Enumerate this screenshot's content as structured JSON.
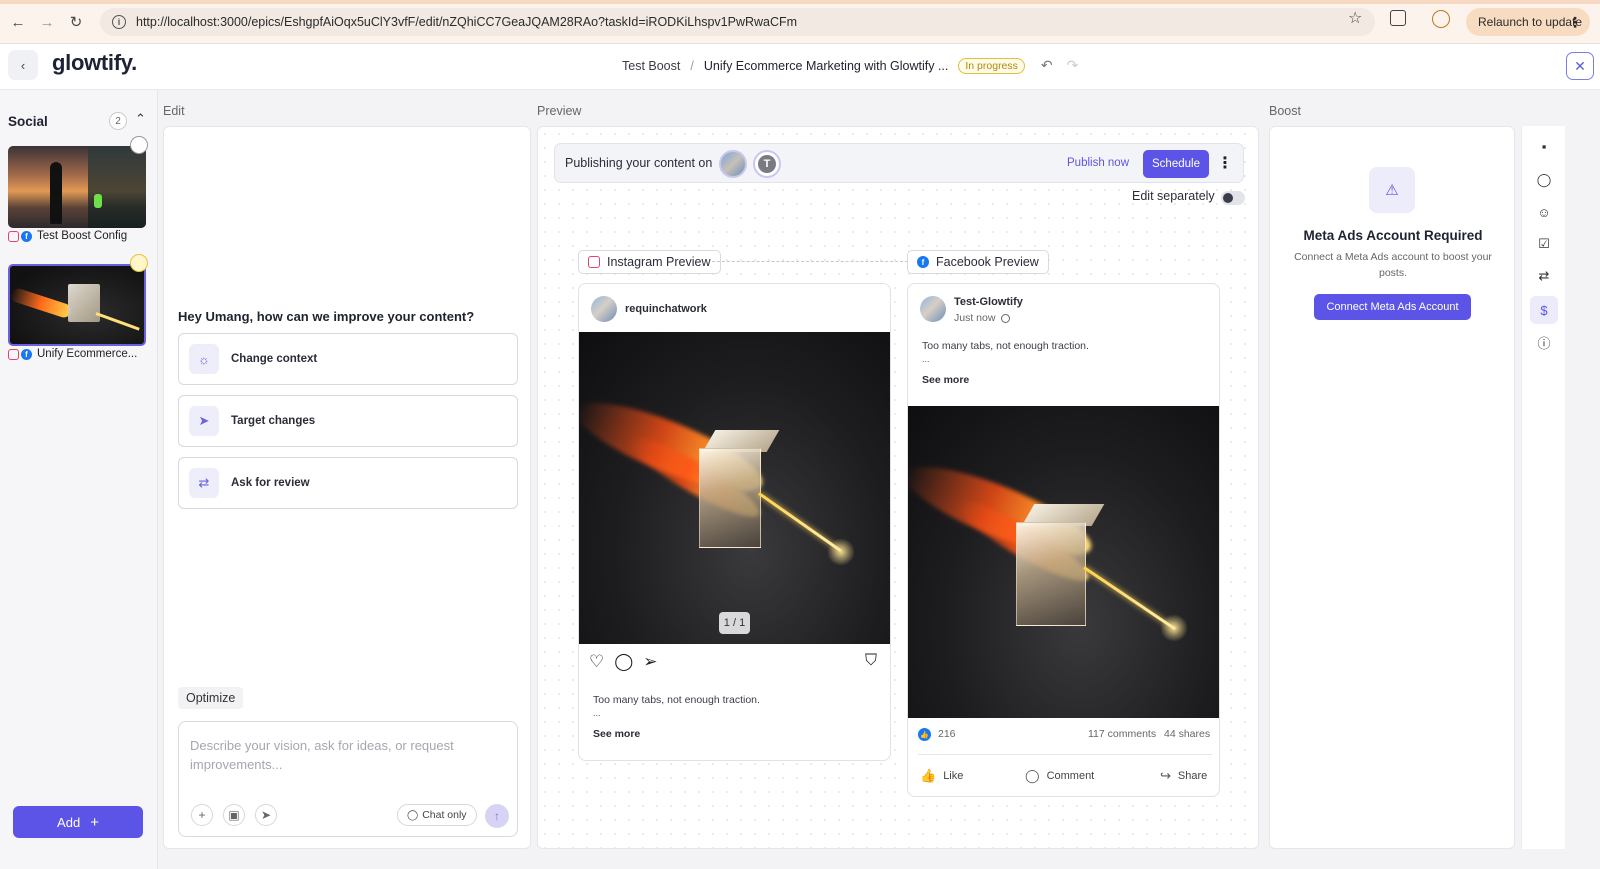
{
  "browser": {
    "url": "http://localhost:3000/epics/EshgpfAiOqx5uClY3vfF/edit/nZQhiCC7GeaJQAM28RAo?taskId=iRODKiLhspv1PwRwaCFm",
    "relaunch_label": "Relaunch to update"
  },
  "app": {
    "logo": "glowtify.",
    "breadcrumb": {
      "parent": "Test Boost",
      "separator": "/",
      "current": "Unify Ecommerce Marketing with Glowtify ...",
      "status": "In progress"
    }
  },
  "sidebar": {
    "title": "Social",
    "count": "2",
    "items": [
      {
        "label": "Test Boost Config"
      },
      {
        "label": "Unify Ecommerce..."
      }
    ],
    "add_label": "Add"
  },
  "sections": {
    "edit": "Edit",
    "preview": "Preview",
    "boost": "Boost"
  },
  "edit": {
    "prompt": "Hey Umang, how can we improve your content?",
    "options": [
      {
        "label": "Change context",
        "icon": "lightbulb-icon"
      },
      {
        "label": "Target changes",
        "icon": "cursor-icon"
      },
      {
        "label": "Ask for review",
        "icon": "share-icon"
      }
    ],
    "optimize_label": "Optimize",
    "chat_placeholder": "Describe your vision, ask for ideas, or request improvements...",
    "chat_only_label": "Chat only"
  },
  "preview": {
    "publishing_label": "Publishing your content on",
    "avatar_letter": "T",
    "publish_now": "Publish now",
    "schedule": "Schedule",
    "edit_separately": "Edit separately",
    "instagram": {
      "chip": "Instagram Preview",
      "account": "requinchatwork",
      "counter": "1 / 1",
      "caption": "Too many tabs, not enough traction.",
      "ellipsis": "...",
      "see_more": "See more"
    },
    "facebook": {
      "chip": "Facebook Preview",
      "account": "Test-Glowtify",
      "time": "Just now",
      "caption": "Too many tabs, not enough traction.",
      "ellipsis": "...",
      "see_more": "See more",
      "likes": "216",
      "comments": "117 comments",
      "shares": "44 shares",
      "actions": {
        "like": "Like",
        "comment": "Comment",
        "share": "Share"
      }
    }
  },
  "boost": {
    "title": "Meta Ads Account Required",
    "description": "Connect a Meta Ads account to boost your posts.",
    "connect_label": "Connect Meta Ads Account"
  },
  "colors": {
    "accent": "#5b54e6",
    "status_badge": "#e0bf3a",
    "facebook": "#1877f2",
    "instagram": "#e0436d"
  }
}
